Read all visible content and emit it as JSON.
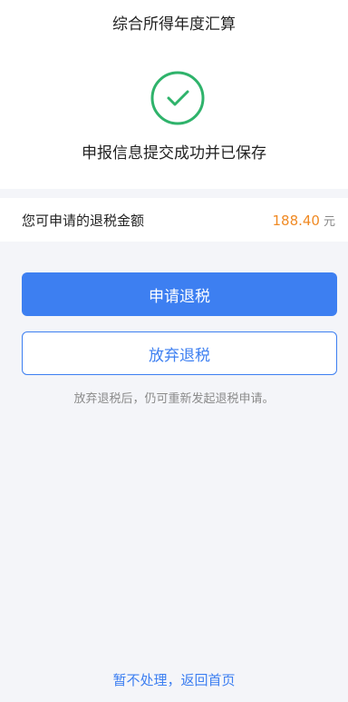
{
  "header": {
    "title": "综合所得年度汇算"
  },
  "result": {
    "icon": "check-circle-icon",
    "message": "申报信息提交成功并已保存"
  },
  "refund": {
    "label": "您可申请的退税金额",
    "amount": "188.40",
    "unit": "元"
  },
  "actions": {
    "apply_label": "申请退税",
    "abandon_label": "放弃退税"
  },
  "hint": "放弃退税后，仍可重新发起退税申请。",
  "footer": {
    "link_label": "暂不处理，返回首页"
  },
  "colors": {
    "accent": "#3d7ff1",
    "success": "#2fb36b",
    "amount": "#f08a24"
  }
}
